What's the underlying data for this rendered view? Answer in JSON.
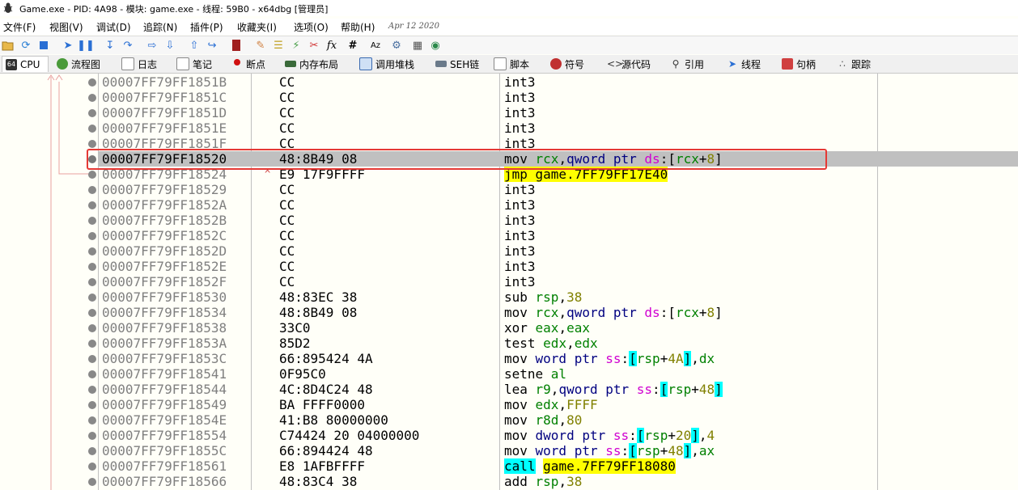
{
  "window": {
    "title": "Game.exe - PID: 4A98 - 模块: game.exe - 线程: 59B0 - x64dbg [管理员]"
  },
  "menu": {
    "items": [
      "文件(F)",
      "视图(V)",
      "调试(D)",
      "追踪(N)",
      "插件(P)",
      "收藏夹(I)",
      "选项(O)",
      "帮助(H)"
    ],
    "date": "Apr 12 2020"
  },
  "toolbar": {
    "icons": [
      "open-icon",
      "restart-icon",
      "close-icon",
      "run-icon",
      "pause-icon",
      "step-into-icon",
      "step-over-icon",
      "trace-into-icon",
      "trace-over-icon",
      "execute-till-return-icon",
      "run-to-user-code-icon",
      "bookmark-icon",
      "patch-icon",
      "comment-icon",
      "label-icon",
      "scylla-icon",
      "function-icon",
      "hash-icon",
      "strings-icon",
      "settings-icon",
      "calculator-icon",
      "globe-icon"
    ],
    "glyphs": {
      "fx": "fx",
      "hash": "#",
      "az": "Az"
    }
  },
  "tabs": [
    {
      "label": "CPU",
      "icon": "cpu-icon"
    },
    {
      "label": "流程图",
      "icon": "graph-icon"
    },
    {
      "label": "日志",
      "icon": "log-icon"
    },
    {
      "label": "笔记",
      "icon": "notes-icon"
    },
    {
      "label": "断点",
      "icon": "breakpoint-icon"
    },
    {
      "label": "内存布局",
      "icon": "memory-icon"
    },
    {
      "label": "调用堆栈",
      "icon": "callstack-icon"
    },
    {
      "label": "SEH链",
      "icon": "seh-icon"
    },
    {
      "label": "脚本",
      "icon": "script-icon"
    },
    {
      "label": "符号",
      "icon": "symbol-icon"
    },
    {
      "label": "源代码",
      "icon": "source-icon"
    },
    {
      "label": "引用",
      "icon": "references-icon"
    },
    {
      "label": "线程",
      "icon": "threads-icon"
    },
    {
      "label": "句柄",
      "icon": "handles-icon"
    },
    {
      "label": "跟踪",
      "icon": "trace-icon"
    }
  ],
  "disasm": {
    "selected_index": 5,
    "rows": [
      {
        "addr": "00007FF79FF1851B",
        "bytes": "CC",
        "dis": [
          {
            "t": "int3"
          }
        ]
      },
      {
        "addr": "00007FF79FF1851C",
        "bytes": "CC",
        "dis": [
          {
            "t": "int3"
          }
        ]
      },
      {
        "addr": "00007FF79FF1851D",
        "bytes": "CC",
        "dis": [
          {
            "t": "int3"
          }
        ]
      },
      {
        "addr": "00007FF79FF1851E",
        "bytes": "CC",
        "dis": [
          {
            "t": "int3"
          }
        ]
      },
      {
        "addr": "00007FF79FF1851F",
        "bytes": "CC",
        "dis": [
          {
            "t": "int3"
          }
        ]
      },
      {
        "addr": "00007FF79FF18520",
        "bytes": "48:8B49 08",
        "dis": [
          {
            "t": "mov "
          },
          {
            "t": "rcx",
            "c": "reg"
          },
          {
            "t": ","
          },
          {
            "t": "qword ptr",
            "c": "ptr"
          },
          {
            "t": " "
          },
          {
            "t": "ds",
            "c": "seg"
          },
          {
            "t": ":["
          },
          {
            "t": "rcx",
            "c": "reg"
          },
          {
            "t": "+"
          },
          {
            "t": "8",
            "c": "num"
          },
          {
            "t": "]"
          }
        ]
      },
      {
        "addr": "00007FF79FF18524",
        "bytes": "E9 17F9FFFF",
        "dis": [
          {
            "t": "jmp game.7FF79FF17E40",
            "c": "jmp"
          }
        ],
        "mark": "^"
      },
      {
        "addr": "00007FF79FF18529",
        "bytes": "CC",
        "dis": [
          {
            "t": "int3"
          }
        ]
      },
      {
        "addr": "00007FF79FF1852A",
        "bytes": "CC",
        "dis": [
          {
            "t": "int3"
          }
        ]
      },
      {
        "addr": "00007FF79FF1852B",
        "bytes": "CC",
        "dis": [
          {
            "t": "int3"
          }
        ]
      },
      {
        "addr": "00007FF79FF1852C",
        "bytes": "CC",
        "dis": [
          {
            "t": "int3"
          }
        ]
      },
      {
        "addr": "00007FF79FF1852D",
        "bytes": "CC",
        "dis": [
          {
            "t": "int3"
          }
        ]
      },
      {
        "addr": "00007FF79FF1852E",
        "bytes": "CC",
        "dis": [
          {
            "t": "int3"
          }
        ]
      },
      {
        "addr": "00007FF79FF1852F",
        "bytes": "CC",
        "dis": [
          {
            "t": "int3"
          }
        ]
      },
      {
        "addr": "00007FF79FF18530",
        "bytes": "48:83EC 38",
        "dis": [
          {
            "t": "sub "
          },
          {
            "t": "rsp",
            "c": "reg"
          },
          {
            "t": ","
          },
          {
            "t": "38",
            "c": "num"
          }
        ]
      },
      {
        "addr": "00007FF79FF18534",
        "bytes": "48:8B49 08",
        "dis": [
          {
            "t": "mov "
          },
          {
            "t": "rcx",
            "c": "reg"
          },
          {
            "t": ","
          },
          {
            "t": "qword ptr",
            "c": "ptr"
          },
          {
            "t": " "
          },
          {
            "t": "ds",
            "c": "seg"
          },
          {
            "t": ":["
          },
          {
            "t": "rcx",
            "c": "reg"
          },
          {
            "t": "+"
          },
          {
            "t": "8",
            "c": "num"
          },
          {
            "t": "]"
          }
        ]
      },
      {
        "addr": "00007FF79FF18538",
        "bytes": "33C0",
        "dis": [
          {
            "t": "xor "
          },
          {
            "t": "eax",
            "c": "reg"
          },
          {
            "t": ","
          },
          {
            "t": "eax",
            "c": "reg"
          }
        ]
      },
      {
        "addr": "00007FF79FF1853A",
        "bytes": "85D2",
        "dis": [
          {
            "t": "test "
          },
          {
            "t": "edx",
            "c": "reg"
          },
          {
            "t": ","
          },
          {
            "t": "edx",
            "c": "reg"
          }
        ]
      },
      {
        "addr": "00007FF79FF1853C",
        "bytes": "66:895424 4A",
        "dis": [
          {
            "t": "mov "
          },
          {
            "t": "word ptr",
            "c": "ptr"
          },
          {
            "t": " "
          },
          {
            "t": "ss",
            "c": "seg"
          },
          {
            "t": ":"
          },
          {
            "t": "[",
            "c": "brk"
          },
          {
            "t": "rsp",
            "c": "reg"
          },
          {
            "t": "+"
          },
          {
            "t": "4A",
            "c": "num"
          },
          {
            "t": "]",
            "c": "brk"
          },
          {
            "t": ","
          },
          {
            "t": "dx",
            "c": "reg"
          }
        ]
      },
      {
        "addr": "00007FF79FF18541",
        "bytes": "0F95C0",
        "dis": [
          {
            "t": "setne "
          },
          {
            "t": "al",
            "c": "reg"
          }
        ]
      },
      {
        "addr": "00007FF79FF18544",
        "bytes": "4C:8D4C24 48",
        "dis": [
          {
            "t": "lea "
          },
          {
            "t": "r9",
            "c": "reg"
          },
          {
            "t": ","
          },
          {
            "t": "qword ptr",
            "c": "ptr"
          },
          {
            "t": " "
          },
          {
            "t": "ss",
            "c": "seg"
          },
          {
            "t": ":"
          },
          {
            "t": "[",
            "c": "brk"
          },
          {
            "t": "rsp",
            "c": "reg"
          },
          {
            "t": "+"
          },
          {
            "t": "48",
            "c": "num"
          },
          {
            "t": "]",
            "c": "brk"
          }
        ]
      },
      {
        "addr": "00007FF79FF18549",
        "bytes": "BA FFFF0000",
        "dis": [
          {
            "t": "mov "
          },
          {
            "t": "edx",
            "c": "reg"
          },
          {
            "t": ","
          },
          {
            "t": "FFFF",
            "c": "num"
          }
        ]
      },
      {
        "addr": "00007FF79FF1854E",
        "bytes": "41:B8 80000000",
        "dis": [
          {
            "t": "mov "
          },
          {
            "t": "r8d",
            "c": "reg"
          },
          {
            "t": ","
          },
          {
            "t": "80",
            "c": "num"
          }
        ]
      },
      {
        "addr": "00007FF79FF18554",
        "bytes": "C74424 20 04000000",
        "dis": [
          {
            "t": "mov "
          },
          {
            "t": "dword ptr",
            "c": "ptr"
          },
          {
            "t": " "
          },
          {
            "t": "ss",
            "c": "seg"
          },
          {
            "t": ":"
          },
          {
            "t": "[",
            "c": "brk"
          },
          {
            "t": "rsp",
            "c": "reg"
          },
          {
            "t": "+"
          },
          {
            "t": "20",
            "c": "num"
          },
          {
            "t": "]",
            "c": "brk"
          },
          {
            "t": ","
          },
          {
            "t": "4",
            "c": "num"
          }
        ]
      },
      {
        "addr": "00007FF79FF1855C",
        "bytes": "66:894424 48",
        "dis": [
          {
            "t": "mov "
          },
          {
            "t": "word ptr",
            "c": "ptr"
          },
          {
            "t": " "
          },
          {
            "t": "ss",
            "c": "seg"
          },
          {
            "t": ":"
          },
          {
            "t": "[",
            "c": "brk"
          },
          {
            "t": "rsp",
            "c": "reg"
          },
          {
            "t": "+"
          },
          {
            "t": "48",
            "c": "num"
          },
          {
            "t": "]",
            "c": "brk"
          },
          {
            "t": ","
          },
          {
            "t": "ax",
            "c": "reg"
          }
        ]
      },
      {
        "addr": "00007FF79FF18561",
        "bytes": "E8 1AFBFFFF",
        "dis": [
          {
            "t": "call",
            "c": "callhl"
          },
          {
            "t": " "
          },
          {
            "t": "game.7FF79FF18080",
            "c": "callt"
          }
        ]
      },
      {
        "addr": "00007FF79FF18566",
        "bytes": "48:83C4 38",
        "dis": [
          {
            "t": "add "
          },
          {
            "t": "rsp",
            "c": "reg"
          },
          {
            "t": ","
          },
          {
            "t": "38",
            "c": "num"
          }
        ]
      }
    ]
  },
  "colors": {
    "highlight_box": "#e53935",
    "selected_row": "#c0c0c0",
    "register": "#008000",
    "number": "#808000",
    "segment": "#d000d0"
  }
}
